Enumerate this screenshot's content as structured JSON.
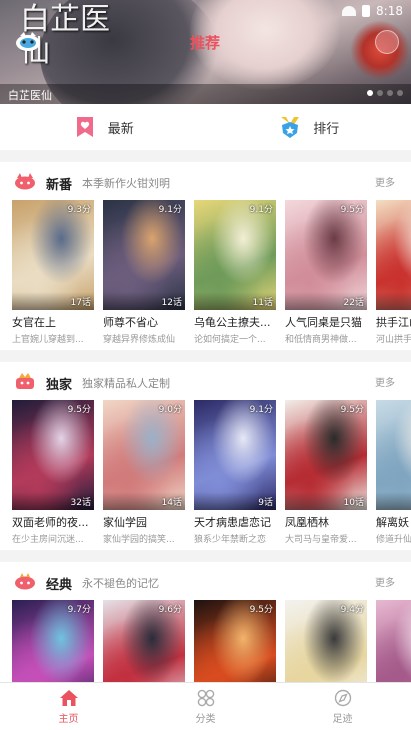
{
  "status_bar": {
    "time": "8:18"
  },
  "banner": {
    "calligraphy": "白芷医仙",
    "top_tab": "推荐",
    "caption": "白芷医仙",
    "dots": 4,
    "active_dot": 0
  },
  "quick_nav": [
    {
      "label": "最新",
      "icon": "bookmark-heart-icon"
    },
    {
      "label": "排行",
      "icon": "medal-shield-icon"
    }
  ],
  "sections": [
    {
      "title": "新番",
      "subtitle": "本季新作火钳刘明",
      "more": "更多",
      "icon": "new-badge-icon",
      "cards": [
        {
          "title": "女官在上",
          "desc": "上官婉儿穿越到...",
          "score": "9.3分",
          "episodes": "17话",
          "colors": [
            "#c8a16a",
            "#e9dcc2",
            "#5a6b8a"
          ]
        },
        {
          "title": "师尊不省心",
          "desc": "穿越异界修炼成仙",
          "score": "9.1分",
          "episodes": "12话",
          "colors": [
            "#2b3346",
            "#6c5d7d",
            "#d9a36e"
          ]
        },
        {
          "title": "乌龟公主撩夫...",
          "desc": "论如何搞定一个...",
          "score": "9.1分",
          "episodes": "11话",
          "colors": [
            "#e7d779",
            "#6f9b5a",
            "#f3efd6"
          ]
        },
        {
          "title": "人气同桌是只猫",
          "desc": "和低情商男神做...",
          "score": "9.5分",
          "episodes": "22话",
          "colors": [
            "#f3d8dc",
            "#d18e9a",
            "#6b3b45"
          ]
        },
        {
          "title": "拱手江山",
          "desc": "河山拱手为君...",
          "score": "",
          "episodes": "",
          "colors": [
            "#f3dfc2",
            "#c9322e",
            "#f6f0e6"
          ]
        }
      ]
    },
    {
      "title": "独家",
      "subtitle": "独家精品私人定制",
      "more": "更多",
      "icon": "exclusive-badge-icon",
      "cards": [
        {
          "title": "双面老师的夜...",
          "desc": "在少主房间沉迷...",
          "score": "9.5分",
          "episodes": "32话",
          "colors": [
            "#1f1c3a",
            "#b23a5a",
            "#e3d3e6"
          ]
        },
        {
          "title": "家仙学园",
          "desc": "家仙学园的搞笑...",
          "score": "9.0分",
          "episodes": "14话",
          "colors": [
            "#f1d6c6",
            "#d17b7b",
            "#9bb0c8"
          ]
        },
        {
          "title": "天才病患虐恋记",
          "desc": "狼系少年禁断之恋",
          "score": "9.1分",
          "episodes": "9话",
          "colors": [
            "#2c2a66",
            "#7f8cd6",
            "#e6e8f6"
          ]
        },
        {
          "title": "凤凰栖林",
          "desc": "大司马与皇帝爱...",
          "score": "9.5分",
          "episodes": "10话",
          "colors": [
            "#f2ede8",
            "#b62c33",
            "#2b2b2b"
          ]
        },
        {
          "title": "解离妖",
          "desc": "修道升仙...",
          "score": "",
          "episodes": "",
          "colors": [
            "#c8dbe6",
            "#7fa5c0",
            "#f5efe9"
          ]
        }
      ]
    },
    {
      "title": "经典",
      "subtitle": "永不褪色的记忆",
      "more": "更多",
      "icon": "classic-badge-icon",
      "cards": [
        {
          "title": "",
          "desc": "",
          "score": "9.7分",
          "episodes": "",
          "colors": [
            "#2a1f52",
            "#c54fb8",
            "#6fc3e0"
          ]
        },
        {
          "title": "",
          "desc": "",
          "score": "9.6分",
          "episodes": "",
          "colors": [
            "#e5e1e7",
            "#c23040",
            "#2a2c3a"
          ]
        },
        {
          "title": "",
          "desc": "",
          "score": "9.5分",
          "episodes": "",
          "colors": [
            "#1e1210",
            "#d84c1f",
            "#f2b36b"
          ]
        },
        {
          "title": "",
          "desc": "",
          "score": "9.4分",
          "episodes": "",
          "colors": [
            "#f3f2ef",
            "#e7d6a0",
            "#3a3a3a"
          ]
        },
        {
          "title": "",
          "desc": "",
          "score": "",
          "episodes": "",
          "colors": [
            "#e8b8d0",
            "#a45a8a",
            "#f5e8ef"
          ]
        }
      ]
    }
  ],
  "bottom_nav": [
    {
      "label": "主页",
      "icon": "home-icon",
      "active": true
    },
    {
      "label": "分类",
      "icon": "category-grid-icon",
      "active": false
    },
    {
      "label": "足迹",
      "icon": "compass-footprint-icon",
      "active": false
    }
  ],
  "accent_color": "#e9525e"
}
